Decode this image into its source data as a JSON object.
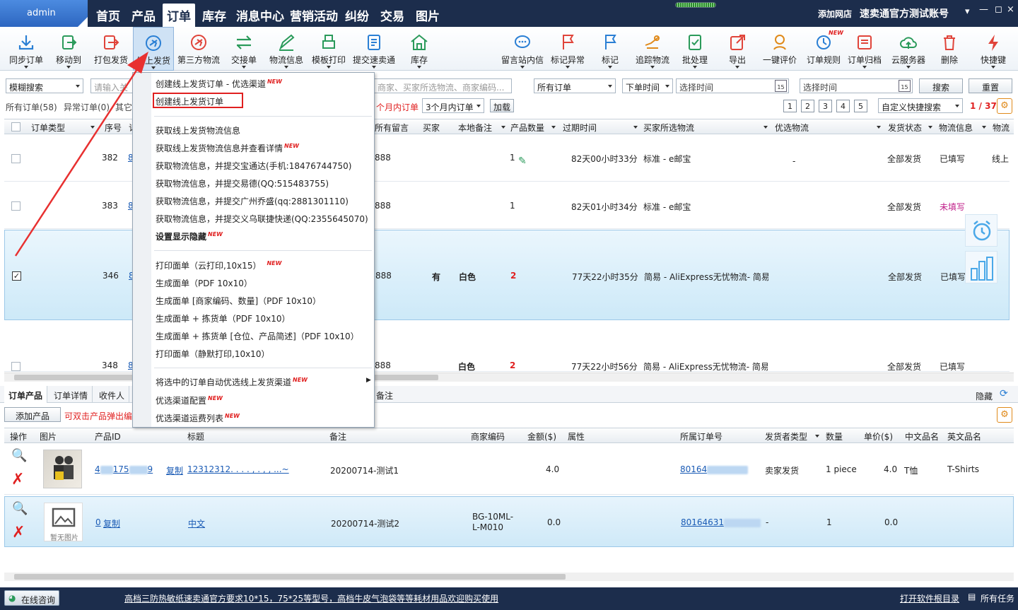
{
  "top_nav": {
    "user": "admin",
    "items": [
      "首页",
      "产品",
      "订单",
      "库存",
      "消息中心",
      "营销活动",
      "纠纷",
      "交易",
      "图片"
    ],
    "active": "订单",
    "add_store": "添加网店",
    "account": "速卖通官方测试账号",
    "window_controls": [
      "▾",
      "—",
      "×"
    ]
  },
  "toolbar": {
    "left": [
      {
        "label": "同步订单",
        "icon": "download-icon",
        "dropdown": true
      },
      {
        "label": "移动到",
        "icon": "move-icon",
        "dropdown": true
      },
      {
        "label": "打包发货",
        "icon": "pack-ship-icon",
        "dropdown": false
      },
      {
        "label": "线上发货",
        "icon": "online-ship-icon",
        "dropdown": true,
        "selected": true
      },
      {
        "label": "第三方物流",
        "icon": "third-party-logistics-icon",
        "dropdown": false
      },
      {
        "label": "交接单",
        "icon": "handover-icon",
        "dropdown": true
      },
      {
        "label": "物流信息",
        "icon": "logistics-info-icon",
        "dropdown": true
      },
      {
        "label": "模板打印",
        "icon": "template-print-icon",
        "dropdown": true
      },
      {
        "label": "提交速卖通",
        "icon": "submit-icon",
        "dropdown": true
      },
      {
        "label": "库存",
        "icon": "warehouse-icon",
        "dropdown": true
      }
    ],
    "right": [
      {
        "label": "留言站内信",
        "icon": "message-icon",
        "dropdown": true
      },
      {
        "label": "标记异常",
        "icon": "flag-red-icon",
        "dropdown": true
      },
      {
        "label": "标记",
        "icon": "flag-blue-icon",
        "dropdown": true
      },
      {
        "label": "追踪物流",
        "icon": "track-icon",
        "dropdown": true
      },
      {
        "label": "批处理",
        "icon": "batch-icon",
        "dropdown": true
      },
      {
        "label": "导出",
        "icon": "export-icon",
        "dropdown": true
      },
      {
        "label": "一键评价",
        "icon": "rate-icon",
        "dropdown": false
      },
      {
        "label": "订单规则",
        "icon": "rules-icon",
        "dropdown": false,
        "badge": "NEW"
      },
      {
        "label": "订单归档",
        "icon": "archive-icon",
        "dropdown": true
      },
      {
        "label": "云服务器",
        "icon": "cloud-icon",
        "dropdown": true
      },
      {
        "label": "删除",
        "icon": "delete-icon",
        "dropdown": false
      },
      {
        "label": "快捷键",
        "icon": "shortcut-icon",
        "dropdown": true
      }
    ]
  },
  "filters": {
    "search_type": "模糊搜索",
    "keyword_placeholder": "请输入关",
    "keyword_hint": "商家、买家所选物流、商家编码...",
    "order_scope": "所有订单",
    "time_type": "下单时间",
    "date_from": "选择时间",
    "date_to": "选择时间",
    "calendar_day": "15",
    "search_btn": "搜索",
    "reset_btn": "重置"
  },
  "order_tabs": {
    "all": "所有订单(58)",
    "abnormal": "异常订单(0)",
    "other": "其它",
    "within_label": "个月内订单",
    "period": "3个月内订单",
    "load_btn": "加载",
    "pages": [
      "1",
      "2",
      "3",
      "4",
      "5"
    ],
    "quick_search": "自定义快捷搜索",
    "page_current": "1",
    "page_total": "37"
  },
  "order_grid": {
    "columns": [
      "订单类型",
      "序号",
      "订",
      "所有留言",
      "买家",
      "本地备注",
      "产品数量",
      "过期时间",
      "买家所选物流",
      "优选物流",
      "发货状态",
      "物流信息",
      "物流"
    ],
    "rows": [
      {
        "seq": "382",
        "id": "8",
        "tail": "888",
        "msg": "",
        "buyer": "",
        "note": "",
        "qty": "1",
        "expire": "82天00小时33分",
        "logistics": "标准 - e邮宝",
        "ship": "全部发货",
        "info": "已填写",
        "extra": "线上"
      },
      {
        "seq": "383",
        "id": "8",
        "tail": "888",
        "msg": "",
        "buyer": "",
        "note": "",
        "qty": "1",
        "expire": "82天01小时34分",
        "logistics": "标准 - e邮宝",
        "ship": "全部发货",
        "info": "未填写",
        "extra": ""
      },
      {
        "seq": "346",
        "id": "8",
        "tail": "888",
        "msg": "有",
        "buyer": "",
        "note": "白色",
        "qty": "2",
        "expire": "77天22小时35分",
        "logistics": "简易 - AliExpress无忧物流- 简易",
        "ship": "全部发货",
        "info": "已填写",
        "extra": ""
      },
      {
        "seq": "348",
        "id": "8",
        "tail": "888",
        "msg": "",
        "buyer": "",
        "note": "白色",
        "qty": "2",
        "expire": "77天22小时56分",
        "logistics": "简易 - AliExpress无忧物流- 简易",
        "ship": "全部发货",
        "info": "已填写",
        "extra": ""
      }
    ]
  },
  "menu": {
    "items": [
      {
        "label": "创建线上发货订单 - 优选渠道",
        "new": true
      },
      {
        "label": "创建线上发货订单",
        "new": false,
        "highlight": true
      },
      {
        "label": "获取线上发货物流信息",
        "new": false
      },
      {
        "label": "获取线上发货物流信息并查看详情",
        "new": true
      },
      {
        "label": "获取物流信息，并提交宝通达(手机:18476744750)",
        "new": false
      },
      {
        "label": "获取物流信息，并提交易德(QQ:515483755)",
        "new": false
      },
      {
        "label": "获取物流信息，并提交广州乔盛(qq:2881301110)",
        "new": false
      },
      {
        "label": "获取物流信息，并提交义乌联捷快递(QQ:2355645070)",
        "new": false
      },
      {
        "label": "设置显示隐藏",
        "new": true,
        "bold": true
      },
      {
        "label": "打印面单（云打印,10x15）",
        "new": true
      },
      {
        "label": "生成面单（PDF 10x10）",
        "new": false
      },
      {
        "label": "生成面单 [商家编码、数量]（PDF 10x10）",
        "new": false
      },
      {
        "label": "生成面单 + 拣货单（PDF 10x10）",
        "new": false
      },
      {
        "label": "生成面单 + 拣货单 [仓位、产品简述]（PDF 10x10）",
        "new": false
      },
      {
        "label": "打印面单（静默打印,10x10）",
        "new": false
      },
      {
        "label": "将选中的订单自动优选线上发货渠道",
        "new": true,
        "submenu": true
      },
      {
        "label": "优选渠道配置",
        "new": true
      },
      {
        "label": "优选渠道运费列表",
        "new": true
      }
    ],
    "new_text": "NEW"
  },
  "bottom": {
    "tabs": [
      "订单产品",
      "订单详情",
      "收件人"
    ],
    "tab_extra": "备注",
    "hide": "隐藏",
    "add_product": "添加产品",
    "hint": "可双击产品弹出编",
    "columns": [
      "操作",
      "图片",
      "产品ID",
      "标题",
      "备注",
      "商家编码",
      "金额($)",
      "属性",
      "所属订单号",
      "发货者类型",
      "数量",
      "单价($)",
      "中文品名",
      "英文品名"
    ],
    "rows": [
      {
        "pid_a": "4",
        "pid_b": "175",
        "pid_c": "9",
        "copy": "复制",
        "title": "12312312. . . . , . , , ...~",
        "note": "20200714-测试1",
        "sku": "",
        "amount": "4.0",
        "order": "80164",
        "shipper": "卖家发货",
        "qty": "1 piece",
        "price": "4.0",
        "cn": "T恤",
        "en": "T-Shirts"
      },
      {
        "pid_a": "0",
        "pid_b": "",
        "pid_c": "",
        "copy": "复制",
        "title": "中文",
        "note": "20200714-测试2",
        "sku": "BG-10ML-L-M010",
        "amount": "0.0",
        "order": "80164631",
        "shipper": "-",
        "qty": "1",
        "price": "0.0",
        "cn": "",
        "en": ""
      }
    ],
    "no_image": "暂无图片"
  },
  "footer": {
    "consult": "在线咨询",
    "ad": "高档三防热敏纸速卖通官方要求10*15，75*25等型号，高档牛皮气泡袋等等耗材用品欢迎购买使用",
    "open_dir": "打开软件根目录",
    "tasks": "所有任务"
  },
  "colors": {
    "nav_bg": "#1c2d4c",
    "selected_row": "#d6ecfb",
    "accent_red": "#e02020",
    "link": "#1a5bb5"
  }
}
